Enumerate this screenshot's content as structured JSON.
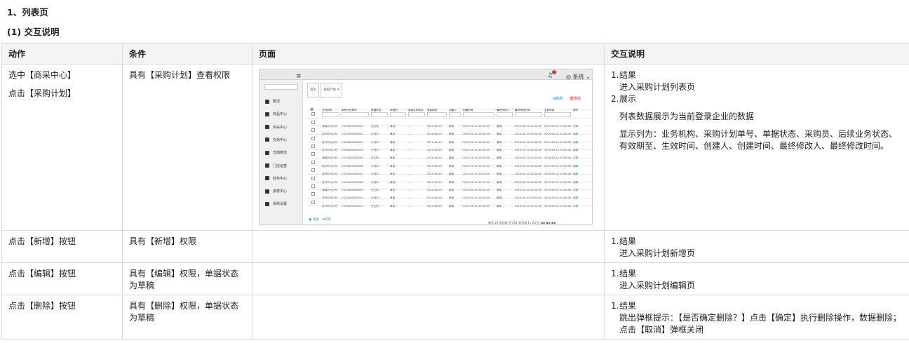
{
  "heading1": "1、列表页",
  "heading2": "(1) 交互说明",
  "table": {
    "headers": [
      "动作",
      "条件",
      "页面",
      "交互说明"
    ],
    "rows": [
      {
        "actions": [
          "选中【商采中心】",
          "点击【采购计划】"
        ],
        "condition": "具有【采购计划】查看权限",
        "steps": [
          {
            "num": "1.",
            "title": "结果",
            "lines": [
              "进入采购计划列表页"
            ]
          },
          {
            "num": "2.",
            "title": "展示",
            "lines": [
              "列表数据展示为当前登录企业的数据",
              "显示列为：业务机构、采购计划单号、单据状态、采购员、后续业务状态、有效期至、生效时间、创建人、创建时间、最终修改人、最终修改时间。"
            ]
          }
        ]
      },
      {
        "actions": [
          "点击【新增】按钮"
        ],
        "condition": "具有【新增】权限",
        "steps": [
          {
            "num": "1.",
            "title": "结果",
            "lines": [
              "进入采购计划新增页"
            ]
          }
        ]
      },
      {
        "actions": [
          "点击【编辑】按钮"
        ],
        "condition": "具有【编辑】权限，单据状态为草稿",
        "steps": [
          {
            "num": "1.",
            "title": "结果",
            "lines": [
              "进入采购计划编辑页"
            ]
          }
        ]
      },
      {
        "actions": [
          "点击【删除】按钮"
        ],
        "condition": "具有【删除】权限，单据状态为草稿",
        "steps": [
          {
            "num": "1.",
            "title": "结果",
            "lines": [
              "跳出弹框提示：【是否确定删除？】点击【确定】执行删除操作，数据删除；点击【取消】弹框关闭"
            ]
          }
        ]
      }
    ]
  },
  "mockup": {
    "user_label": "系统",
    "sidebar_items": [
      "概况",
      "商品中心",
      "商采中心",
      "交易中心",
      "仓储物流",
      "门店运营",
      "财务中心",
      "报表中心",
      "系统设置"
    ],
    "tabs": [
      "首页",
      "采购计划"
    ],
    "add_label": "新增",
    "delete_label": "删除",
    "columns": [
      "业务机构",
      "采购计划单号",
      "单据状态",
      "采购员",
      "后续业务状态",
      "有效期至",
      "创建人",
      "创建时间",
      "最终修改人",
      "最终修改时间",
      "生效时间",
      "操作"
    ],
    "rows": [
      {
        "org": "海南市分公司",
        "no": "CG20000000001",
        "status": "已生效",
        "buyer": "黄某",
        "next": "—",
        "valid": "2019-06-10",
        "creator": "黄某",
        "ctime": "2019-05-10 10:00:00",
        "modifier": "黄某",
        "mtime": "2019-05-10 10:00:00",
        "etime": "2019-05-10 10:00:00",
        "op": "详情"
      },
      {
        "org": "苏州市分公司",
        "no": "CG20000000002",
        "status": "计划中",
        "buyer": "黄某",
        "next": "—",
        "valid": "2019-06-10",
        "creator": "黄某",
        "ctime": "2019-05-10 10:00:00",
        "modifier": "黄某",
        "mtime": "2019-05-10 10:00:00",
        "etime": "2019-05-10 10:00:00",
        "op": "编辑"
      },
      {
        "org": "苏州市分公司",
        "no": "CG20000000003",
        "status": "计划中",
        "buyer": "黄某",
        "next": "—",
        "valid": "2019-06-10",
        "creator": "黄某",
        "ctime": "2019-05-10 10:00:00",
        "modifier": "黄某",
        "mtime": "2019-05-10 10:00:00",
        "etime": "2019-05-10 10:00:00",
        "op": "编辑"
      },
      {
        "org": "苏州市分公司",
        "no": "CG20000000004",
        "status": "计划中",
        "buyer": "黄某",
        "next": "—",
        "valid": "2019-06-10",
        "creator": "黄某",
        "ctime": "2019-05-10 10:00:00",
        "modifier": "黄某",
        "mtime": "2019-05-10 10:00:00",
        "etime": "2019-05-10 10:00:00",
        "op": "编辑"
      },
      {
        "org": "海南市分公司",
        "no": "CG20000000005",
        "status": "已生效",
        "buyer": "黄某",
        "next": "—",
        "valid": "2019-06-10",
        "creator": "黄某",
        "ctime": "2019-05-10 10:00:00",
        "modifier": "黄某",
        "mtime": "2019-05-10 10:00:00",
        "etime": "2019-05-10 10:00:00",
        "op": "详情"
      },
      {
        "org": "苏州市分公司",
        "no": "CG20000000006",
        "status": "计划中",
        "buyer": "黄某",
        "next": "—",
        "valid": "2019-06-10",
        "creator": "黄某",
        "ctime": "2019-05-10 10:00:00",
        "modifier": "黄某",
        "mtime": "2019-05-10 10:00:00",
        "etime": "2019-05-10 10:00:00",
        "op": "编辑"
      },
      {
        "org": "苏州市分公司",
        "no": "CG20000000007",
        "status": "计划中",
        "buyer": "黄某",
        "next": "—",
        "valid": "2019-06-10",
        "creator": "黄某",
        "ctime": "2019-05-10 10:00:00",
        "modifier": "黄某",
        "mtime": "2019-05-10 10:00:00",
        "etime": "2019-05-10 10:00:00",
        "op": "编辑"
      },
      {
        "org": "苏州市分公司",
        "no": "CG20000000008",
        "status": "计划中",
        "buyer": "黄某",
        "next": "—",
        "valid": "2019-06-10",
        "creator": "黄某",
        "ctime": "2019-05-10 10:00:00",
        "modifier": "黄某",
        "mtime": "2019-05-10 10:00:00",
        "etime": "2019-05-10 10:00:00",
        "op": "编辑"
      },
      {
        "org": "海南市分公司",
        "no": "CG20000000009",
        "status": "已生效",
        "buyer": "黄某",
        "next": "—",
        "valid": "2019-06-10",
        "creator": "黄某",
        "ctime": "2019-05-10 10:00:00",
        "modifier": "黄某",
        "mtime": "2019-05-10 10:00:00",
        "etime": "2019-05-10 10:00:00",
        "op": "详情"
      },
      {
        "org": "苏州市分公司",
        "no": "CG20000000010",
        "status": "计划中",
        "buyer": "黄某",
        "next": "—",
        "valid": "2019-06-10",
        "creator": "黄某",
        "ctime": "2019-05-10 10:00:00",
        "modifier": "黄某",
        "mtime": "2019-05-10 10:00:00",
        "etime": "2019-05-10 10:00:00",
        "op": "编辑"
      },
      {
        "org": "苏州市分公司",
        "no": "CG20000000011",
        "status": "已生效",
        "buyer": "黄某",
        "next": "—",
        "valid": "2019-06-10",
        "creator": "黄某",
        "ctime": "2019-05-10 10:00:00",
        "modifier": "黄某",
        "mtime": "2019-05-10 10:00:00",
        "etime": "2019-05-10 10:00:00",
        "op": "详情"
      }
    ],
    "footer_left": "导出",
    "footer_right": "打印",
    "pager": "每页 20 条记录  共 201 条记录  1 / 24 页"
  }
}
